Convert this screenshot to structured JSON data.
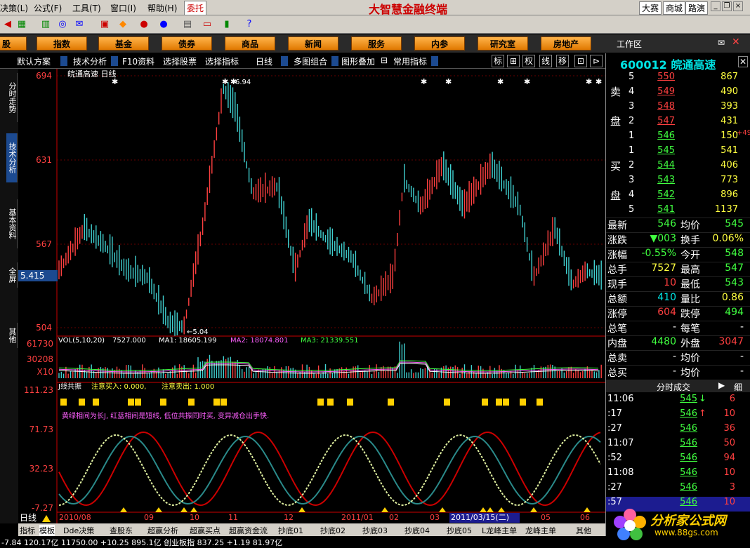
{
  "menu": {
    "items": [
      "决策(L)",
      "公式(F)",
      "工具(T)",
      "窗口(I)",
      "帮助(H)"
    ],
    "weituo": "委托",
    "brand": "大智慧金融终端",
    "right_buttons": [
      "大赛",
      "商城",
      "路演"
    ]
  },
  "nav": {
    "items": [
      "股",
      "指数",
      "基金",
      "债券",
      "商品",
      "新闻",
      "服务",
      "内参",
      "研究室",
      "房地产"
    ],
    "workspace": "工作区"
  },
  "controls": {
    "items": [
      "默认方案",
      "技术分析",
      "F10资料",
      "选择股票",
      "选择指标",
      "日线",
      "多图组合",
      "图形叠加",
      "常用指标"
    ],
    "right_buttons": [
      "标",
      "⊞",
      "权",
      "线",
      "移",
      "⊡",
      "⊳"
    ]
  },
  "left_tabs": [
    "分时走势",
    "技术分析",
    "基本资料",
    "全屏",
    "其他"
  ],
  "price_tag": "5.415",
  "main_chart": {
    "title": "皖通高速 日线",
    "y_labels": [
      "694",
      "631",
      "567",
      "504"
    ],
    "high_note": "6.94",
    "low_note": "←5.04"
  },
  "volume": {
    "header": "VOL(5,10,20)",
    "vol": "7527.000",
    "ma1": "MA1: 18605.199",
    "ma2": "MA2: 18074.801",
    "ma3": "MA3: 21339.551",
    "y_labels": [
      "61730",
      "30208",
      "X10"
    ]
  },
  "indicator": {
    "header": "J线共振",
    "buy": "注意买入: 0.000,",
    "sell": "注意卖出: 1.000",
    "note": "黄绿相间为长J, 红蓝相间是短线, 低位共振同时买, 变异减仓出手快.",
    "y_labels": [
      "111.23",
      "71.73",
      "32.23",
      "-7.27"
    ]
  },
  "date_axis": {
    "labels": [
      "2010/08",
      "09",
      "10",
      "11",
      "12",
      "2011/01",
      "02",
      "03",
      "2011/03/15(二)",
      "05",
      "06"
    ],
    "period": "日线"
  },
  "bottom_tabs": [
    "指标",
    "模板",
    "Dde决策",
    "查股东",
    "超赢分析",
    "超赢买点",
    "超赢资金流",
    "抄底01",
    "抄底02",
    "抄底03",
    "抄底04",
    "抄底05",
    "L龙峰主单",
    "龙峰主单",
    "其他"
  ],
  "right_panel": {
    "code": "600012",
    "name": "皖通高速",
    "sell_label": [
      "卖",
      "盘"
    ],
    "buy_label": [
      "买",
      "盘"
    ],
    "sell_orders": [
      {
        "lv": "5",
        "price": "550",
        "vol": "867"
      },
      {
        "lv": "4",
        "price": "549",
        "vol": "490"
      },
      {
        "lv": "3",
        "price": "548",
        "vol": "393"
      },
      {
        "lv": "2",
        "price": "547",
        "vol": "431"
      },
      {
        "lv": "1",
        "price": "546",
        "vol": "150"
      }
    ],
    "buy_orders": [
      {
        "lv": "1",
        "price": "545",
        "vol": "541"
      },
      {
        "lv": "2",
        "price": "544",
        "vol": "406"
      },
      {
        "lv": "3",
        "price": "543",
        "vol": "773"
      },
      {
        "lv": "4",
        "price": "542",
        "vol": "896"
      },
      {
        "lv": "5",
        "price": "541",
        "vol": "1137"
      }
    ],
    "sell1_extra": "+49",
    "quotes": [
      {
        "k1": "最新",
        "v1": "546",
        "c1": "#40ff40",
        "k2": "均价",
        "v2": "545",
        "c2": "#40ff40"
      },
      {
        "k1": "涨跌",
        "v1": "▼003",
        "c1": "#40ff40",
        "k2": "换手",
        "v2": "0.06%",
        "c2": "#ffff40"
      },
      {
        "k1": "涨幅",
        "v1": "-0.55%",
        "c1": "#40ff40",
        "k2": "今开",
        "v2": "548",
        "c2": "#40ff40"
      },
      {
        "k1": "总手",
        "v1": "7527",
        "c1": "#ffff40",
        "k2": "最高",
        "v2": "547",
        "c2": "#40ff40"
      },
      {
        "k1": "现手",
        "v1": "10",
        "c1": "#ff4040",
        "k2": "最低",
        "v2": "543",
        "c2": "#40ff40"
      },
      {
        "k1": "总额",
        "v1": "410",
        "c1": "#00e5e5",
        "k2": "量比",
        "v2": "0.86",
        "c2": "#ffff40"
      },
      {
        "k1": "涨停",
        "v1": "604",
        "c1": "#ff4040",
        "k2": "跌停",
        "v2": "494",
        "c2": "#40ff40"
      },
      {
        "k1": "总笔",
        "v1": "-",
        "c1": "#fff",
        "k2": "每笔",
        "v2": "-",
        "c2": "#fff"
      },
      {
        "k1": "内盘",
        "v1": "4480",
        "c1": "#40ff40",
        "k2": "外盘",
        "v2": "3047",
        "c2": "#ff4040"
      },
      {
        "k1": "总卖",
        "v1": "-",
        "c1": "#fff",
        "k2": "均价",
        "v2": "-",
        "c2": "#fff"
      },
      {
        "k1": "总买",
        "v1": "-",
        "c1": "#fff",
        "k2": "均价",
        "v2": "-",
        "c2": "#fff"
      }
    ],
    "tick_header": "分时成交",
    "tick_tab": "细",
    "ticks": [
      {
        "t": "11:06",
        "p": "545",
        "arrow": "↓",
        "v": "6"
      },
      {
        "t": ":17",
        "p": "546",
        "arrow": "↑",
        "v": "10"
      },
      {
        "t": ":27",
        "p": "546",
        "arrow": "",
        "v": "36"
      },
      {
        "t": "11:07",
        "p": "546",
        "arrow": "",
        "v": "50"
      },
      {
        "t": ":52",
        "p": "546",
        "arrow": "",
        "v": "94"
      },
      {
        "t": "11:08",
        "p": "546",
        "arrow": "",
        "v": "10"
      },
      {
        "t": ":27",
        "p": "546",
        "arrow": "",
        "v": "3"
      },
      {
        "t": ":57",
        "p": "546",
        "arrow": "",
        "v": "10"
      }
    ]
  },
  "watermark": {
    "title": "分析家公式网",
    "url": "www.88gs.com"
  },
  "status": {
    "text": "-7.84 120.17亿 11750.00 +10.25 895.1亿 创业板指 837.25 +1.19 81.97亿"
  },
  "colors": {
    "up": "#ff4040",
    "down": "#40e0e0",
    "accent": "#00e5e5",
    "nav": "#e07800"
  }
}
